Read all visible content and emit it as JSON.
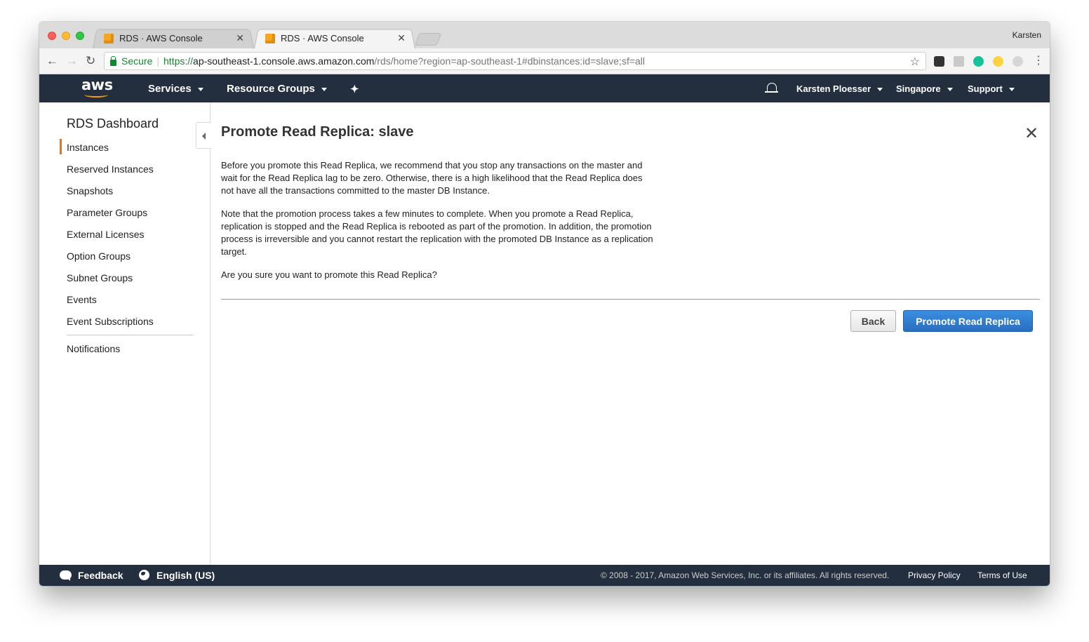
{
  "browser": {
    "tabs": [
      {
        "title": "RDS · AWS Console"
      },
      {
        "title": "RDS · AWS Console"
      }
    ],
    "profile_name": "Karsten",
    "secure_label": "Secure",
    "url_scheme": "https://",
    "url_host": "ap-southeast-1.console.aws.amazon.com",
    "url_path": "/rds/home?region=ap-southeast-1#dbinstances:id=slave;sf=all"
  },
  "aws_nav": {
    "logo_text": "aws",
    "services_label": "Services",
    "resource_groups_label": "Resource Groups",
    "user_label": "Karsten Ploesser",
    "region_label": "Singapore",
    "support_label": "Support"
  },
  "sidebar": {
    "title": "RDS Dashboard",
    "items": [
      {
        "label": "Instances",
        "active": true
      },
      {
        "label": "Reserved Instances"
      },
      {
        "label": "Snapshots"
      },
      {
        "label": "Parameter Groups"
      },
      {
        "label": "External Licenses"
      },
      {
        "label": "Option Groups"
      },
      {
        "label": "Subnet Groups"
      },
      {
        "label": "Events"
      },
      {
        "label": "Event Subscriptions"
      },
      {
        "label": "Notifications"
      }
    ]
  },
  "main": {
    "title": "Promote Read Replica: slave",
    "paragraphs": [
      "Before you promote this Read Replica, we recommend that you stop any transactions on the master and wait for the Read Replica lag to be zero. Otherwise, there is a high likelihood that the Read Replica does not have all the transactions committed to the master DB Instance.",
      "Note that the promotion process takes a few minutes to complete. When you promote a Read Replica, replication is stopped and the Read Replica is rebooted as part of the promotion. In addition, the promotion process is irreversible and you cannot restart the replication with the promoted DB Instance as a replication target.",
      "Are you sure you want to promote this Read Replica?"
    ],
    "back_label": "Back",
    "promote_label": "Promote Read Replica"
  },
  "footer": {
    "feedback_label": "Feedback",
    "language_label": "English (US)",
    "copyright": "© 2008 - 2017, Amazon Web Services, Inc. or its affiliates. All rights reserved.",
    "privacy_label": "Privacy Policy",
    "terms_label": "Terms of Use"
  },
  "colors": {
    "nav_bg": "#232f3e",
    "accent": "#ff9900",
    "primary_button": "#2a6fc2"
  }
}
